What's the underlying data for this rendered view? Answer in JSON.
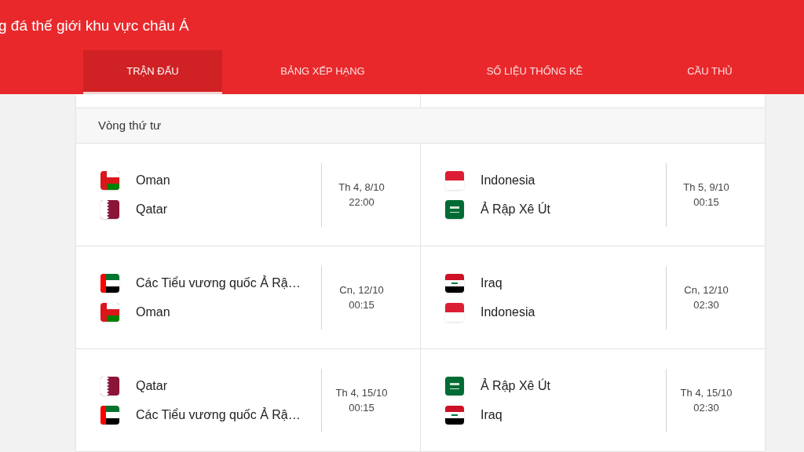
{
  "header": {
    "title": "g đá thế giới khu vực châu Á"
  },
  "tabs": [
    {
      "label": "TRẬN ĐẤU",
      "selected": true
    },
    {
      "label": "BẢNG XẾP HẠNG",
      "selected": false
    },
    {
      "label": "SỐ LIỆU THỐNG KÊ",
      "selected": false
    },
    {
      "label": "CẦU THỦ",
      "selected": false
    }
  ],
  "round": {
    "title": "Vòng thứ tư"
  },
  "match_rows": [
    [
      {
        "teams": [
          {
            "name": "Oman",
            "kind": "oman"
          },
          {
            "name": "Qatar",
            "kind": "qatar"
          }
        ],
        "date": "Th 4, 8/10",
        "time": "22:00"
      },
      {
        "teams": [
          {
            "name": "Indonesia",
            "kind": "indonesia"
          },
          {
            "name": "Ả Rập Xê Út",
            "kind": "saudi"
          }
        ],
        "date": "Th 5, 9/10",
        "time": "00:15"
      }
    ],
    [
      {
        "teams": [
          {
            "name": "Các Tiểu vương quốc Ả Rậ…",
            "kind": "uae"
          },
          {
            "name": "Oman",
            "kind": "oman"
          }
        ],
        "date": "Cn, 12/10",
        "time": "00:15"
      },
      {
        "teams": [
          {
            "name": "Iraq",
            "kind": "iraq"
          },
          {
            "name": "Indonesia",
            "kind": "indonesia"
          }
        ],
        "date": "Cn, 12/10",
        "time": "02:30"
      }
    ],
    [
      {
        "teams": [
          {
            "name": "Qatar",
            "kind": "qatar"
          },
          {
            "name": "Các Tiểu vương quốc Ả Rậ…",
            "kind": "uae"
          }
        ],
        "date": "Th 4, 15/10",
        "time": "00:15"
      },
      {
        "teams": [
          {
            "name": "Ả Rập Xê Út",
            "kind": "saudi"
          },
          {
            "name": "Iraq",
            "kind": "iraq"
          }
        ],
        "date": "Th 4, 15/10",
        "time": "02:30"
      }
    ]
  ]
}
